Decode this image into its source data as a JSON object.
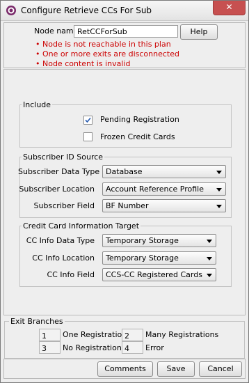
{
  "window": {
    "title": "Configure Retrieve CCs For Sub",
    "close_label": "✕"
  },
  "node": {
    "name_label": "Node name",
    "name_value": "RetCCForSub",
    "help_label": "Help",
    "errors": [
      "• Node is not reachable in this plan",
      "• One or more exits are disconnected",
      "• Node content is invalid"
    ]
  },
  "include": {
    "title": "Include",
    "items": [
      {
        "label": "Pending Registration",
        "checked": true
      },
      {
        "label": "Frozen Credit Cards",
        "checked": false
      }
    ]
  },
  "subscriber": {
    "title": "Subscriber ID Source",
    "rows": [
      {
        "label": "Subscriber Data Type",
        "value": "Database"
      },
      {
        "label": "Subscriber Location",
        "value": "Account Reference Profile"
      },
      {
        "label": "Subscriber Field",
        "value": "BF Number"
      }
    ]
  },
  "cc_target": {
    "title": "Credit Card Information Target",
    "rows": [
      {
        "label": "CC Info Data Type",
        "value": "Temporary Storage"
      },
      {
        "label": "CC Info Location",
        "value": "Temporary Storage"
      },
      {
        "label": "CC Info Field",
        "value": "CCS-CC Registered Cards"
      }
    ]
  },
  "exits": {
    "title": "Exit Branches",
    "items": [
      {
        "num": "1",
        "label": "One Registration"
      },
      {
        "num": "2",
        "label": "Many Registrations"
      },
      {
        "num": "3",
        "label": "No Registrations"
      },
      {
        "num": "4",
        "label": "Error"
      }
    ]
  },
  "footer": {
    "comments_label": "Comments",
    "save_label": "Save",
    "cancel_label": "Cancel"
  }
}
